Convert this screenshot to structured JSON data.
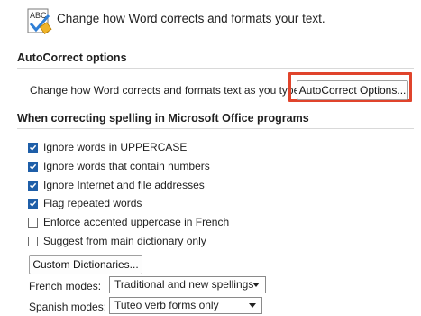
{
  "header": {
    "icon": "abc-spellcheck-icon",
    "icon_text": "ABC",
    "text": "Change how Word corrects and formats your text."
  },
  "autocorrect": {
    "title": "AutoCorrect options",
    "label": "Change how Word corrects and formats text as you type:",
    "button": "AutoCorrect Options...",
    "highlight_color": "#e0442c"
  },
  "spelling": {
    "title": "When correcting spelling in Microsoft Office programs",
    "options": [
      {
        "label": "Ignore words in UPPERCASE",
        "checked": true
      },
      {
        "label": "Ignore words that contain numbers",
        "checked": true
      },
      {
        "label": "Ignore Internet and file addresses",
        "checked": true
      },
      {
        "label": "Flag repeated words",
        "checked": true
      },
      {
        "label": "Enforce accented uppercase in French",
        "checked": false
      },
      {
        "label": "Suggest from main dictionary only",
        "checked": false
      }
    ],
    "dictionaries_button": "Custom Dictionaries...",
    "french_modes": {
      "label": "French modes:",
      "value": "Traditional and new spellings"
    },
    "spanish_modes": {
      "label": "Spanish modes:",
      "value": "Tuteo verb forms only"
    }
  },
  "colors": {
    "checkbox_checked": "#1e5ea8",
    "accent": "#e0442c"
  }
}
